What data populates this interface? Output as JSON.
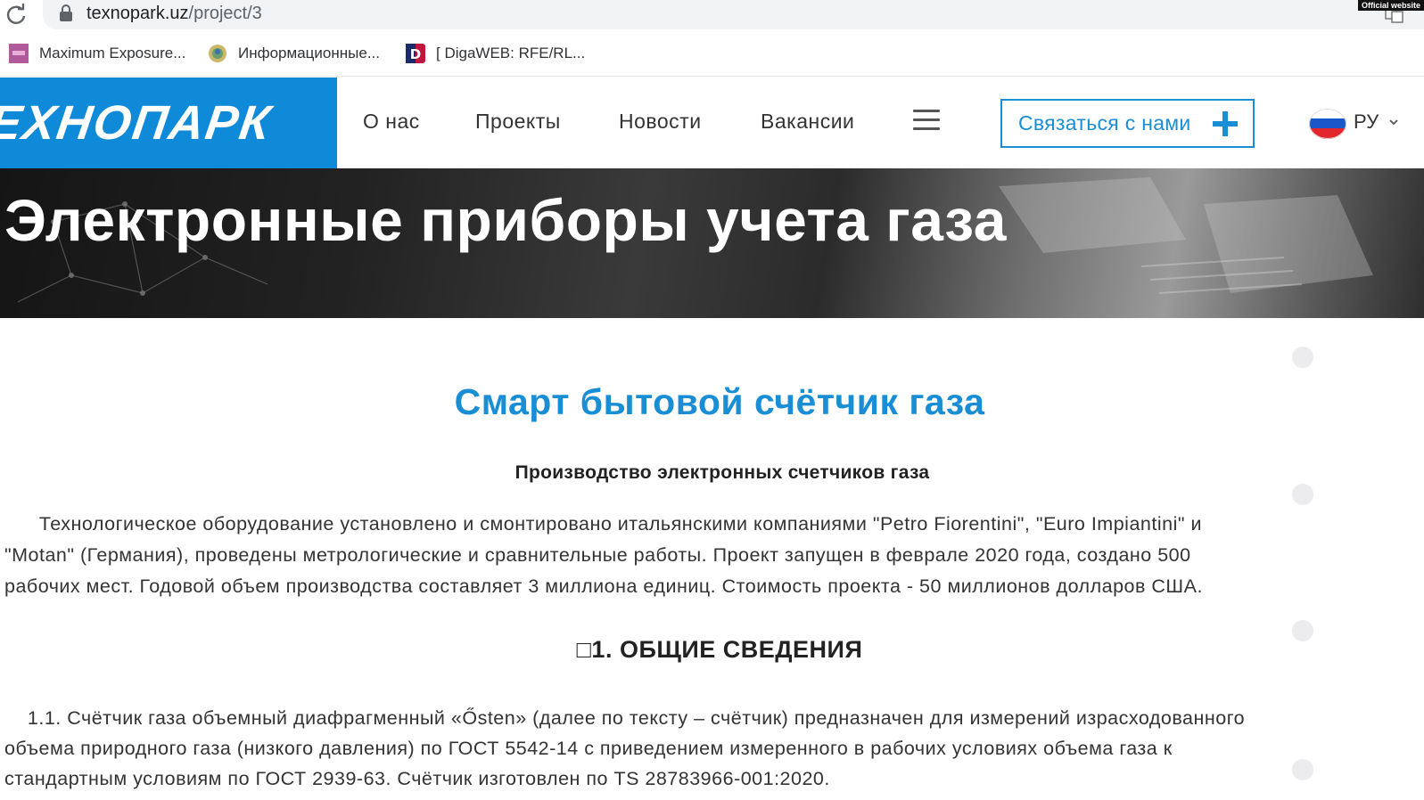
{
  "browser": {
    "url_host": "texnopark.uz",
    "url_path": "/project/3",
    "badge": "Official website",
    "bookmarks": [
      {
        "label": "Maximum Exposure...",
        "icon": "maximum-exposure-favicon"
      },
      {
        "label": "Информационные...",
        "icon": "emblem-favicon"
      },
      {
        "label": "[ DigaWEB: RFE/RL...",
        "icon": "digaweb-favicon"
      }
    ]
  },
  "header": {
    "logo": "ЕХНОПАРК",
    "nav": [
      "О нас",
      "Проекты",
      "Новости",
      "Вакансии"
    ],
    "contact_button": "Связаться с нами",
    "language": "РУ"
  },
  "hero": {
    "title": "Электронные приборы учета газа"
  },
  "content": {
    "title": "Смарт бытовой счётчик газа",
    "subtitle": "Производство электронных счетчиков газа",
    "intro_lines": [
      "      Технологическое оборудование установлено и смонтировано итальянскими компаниями \"Petro Fiorentini\", \"Euro Impiantini\" и",
      "\"Motan\" (Германия), проведены метрологические и сравнительные работы. Проект запущен в феврале 2020 года, создано 500",
      "рабочих мест. Годовой объем производства составляет 3 миллиона единиц. Стоимость проекта - 50 миллионов долларов США."
    ],
    "section_heading": "□1. ОБЩИЕ СВЕДЕНИЯ",
    "section_lines": [
      "    1.1. Счётчик газа объемный диафрагменный «Ősten» (далее по тексту – счётчик) предназначен для измерений израсходованного",
      "объема природного газа (низкого давления) по ГОСТ 5542-14 с приведением измеренного в рабочих условиях объема газа к",
      "стандартным условиям по ГОСТ 2939-63. Счётчик изготовлен по TS 28783966-001:2020."
    ]
  },
  "colors": {
    "brand_blue": "#0e8ad9",
    "title_blue": "#1a8ed5"
  }
}
